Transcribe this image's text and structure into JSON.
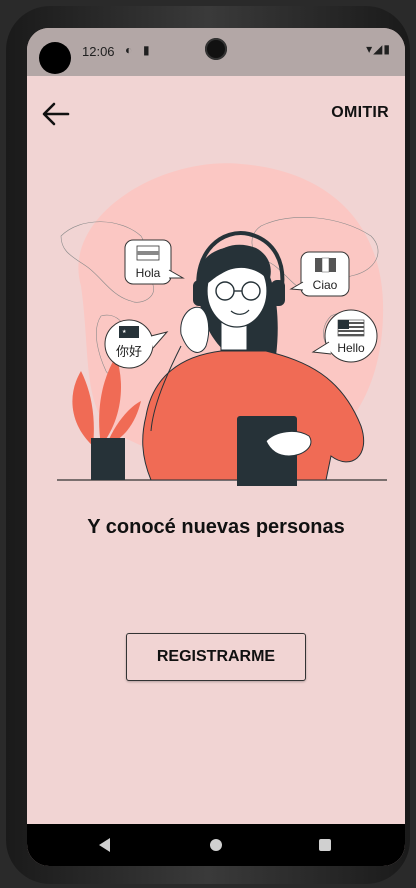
{
  "status_bar": {
    "time": "12:06",
    "icons": [
      "status-app-icon",
      "sd-card-icon"
    ],
    "system_icons": [
      "wifi-icon",
      "signal-icon",
      "battery-icon"
    ]
  },
  "header": {
    "back_icon": "arrow-left-icon",
    "skip_label": "OMITIR"
  },
  "illustration": {
    "bubbles": [
      {
        "text": "Hola",
        "flag": "flag-icon"
      },
      {
        "text": "Ciao",
        "flag": "italy-flag-icon"
      },
      {
        "text": "你好",
        "flag": "china-flag-icon"
      },
      {
        "text": "Hello",
        "flag": "usa-flag-icon"
      }
    ],
    "accent_color": "#f06b55",
    "blob_color": "#fbc7c3"
  },
  "content": {
    "subtitle": "Y conocé nuevas personas",
    "register_label": "REGISTRARME"
  },
  "navigation": {
    "buttons": [
      "nav-back-icon",
      "nav-home-icon",
      "nav-recents-icon"
    ]
  },
  "colors": {
    "background": "#f1d4d3",
    "status_bar": "#b3a7a6",
    "text": "#111111"
  }
}
